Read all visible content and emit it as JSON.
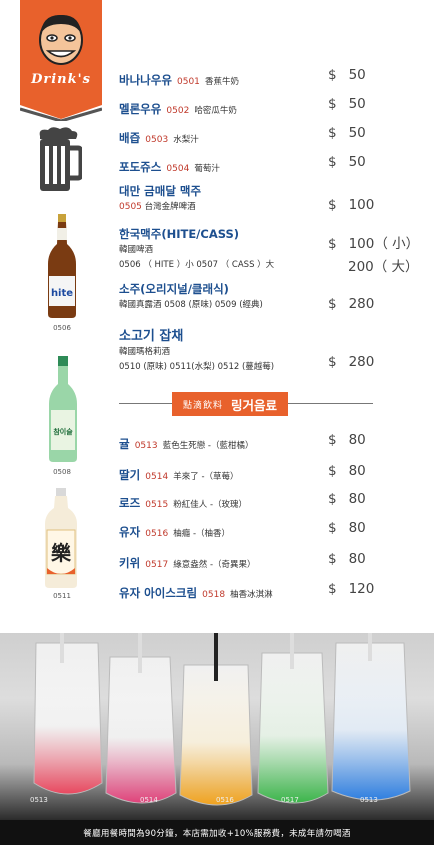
{
  "header": {
    "brand": "Drink's"
  },
  "bottle_codes": [
    "0506",
    "0508",
    "0511"
  ],
  "bottle_labels": {
    "hite": "hite",
    "soju": "참이슬",
    "makgeolli": "樂"
  },
  "drinks": [
    {
      "kr": "바나나우유",
      "code": "0501",
      "zh": "香蕉牛奶",
      "price": "50"
    },
    {
      "kr": "멜론우유",
      "code": "0502",
      "zh": "哈密瓜牛奶",
      "price": "50"
    },
    {
      "kr": "배즙",
      "code": "0503",
      "zh": "水梨汁",
      "price": "50"
    },
    {
      "kr": "포도쥬스",
      "code": "0504",
      "zh": "葡萄汁",
      "price": "50"
    },
    {
      "kr": "대만 금매달 맥주",
      "code": "0505",
      "zh": "台灣金牌啤酒",
      "price": "100"
    },
    {
      "kr": "한국맥주(HITE/CASS)",
      "sub": "韓國啤酒",
      "line": "0506 （ HITE ）小 0507 （ CASS ）大",
      "price": "100（ 小）",
      "price2": "200（ 大）"
    },
    {
      "kr": "소주(오리지널/클래식)",
      "line": "韓國真露酒 0508 (原味) 0509 (經典)",
      "price": "280"
    },
    {
      "kr": "소고기 잡채",
      "sub": "韓國瑪格莉酒",
      "line": "0510 (原味) 0511(水梨) 0512 (蔓越莓)",
      "price": "280"
    }
  ],
  "section": {
    "zh": "點滴飲料",
    "kr": "링거음료"
  },
  "drips": [
    {
      "kr": "귤",
      "code": "0513",
      "zh": "藍色生死戀 -（藍柑橘）",
      "price": "80"
    },
    {
      "kr": "딸기",
      "code": "0514",
      "zh": "羊來了 -（草莓）",
      "price": "80"
    },
    {
      "kr": "로즈",
      "code": "0515",
      "zh": "粉紅佳人 -（玫瑰）",
      "price": "80"
    },
    {
      "kr": "유자",
      "code": "0516",
      "zh": "柚癮 -（柚香）",
      "price": "80"
    },
    {
      "kr": "키위",
      "code": "0517",
      "zh": "綠意盎然 -（奇異果）",
      "price": "80"
    },
    {
      "kr": "유자 아이스크림",
      "code": "0518",
      "zh": "柚香冰淇淋",
      "price": "120"
    }
  ],
  "currency": "$",
  "photo_codes": [
    "0513",
    "0514",
    "0516",
    "0517",
    "0513"
  ],
  "pouch_colors": [
    "#e8485f",
    "#e0427a",
    "#f0a21e",
    "#3bb54a",
    "#2f7fe0"
  ],
  "footer": "餐廳用餐時間為90分鐘，本店需加收+10%服務費，未成年請勿喝酒"
}
